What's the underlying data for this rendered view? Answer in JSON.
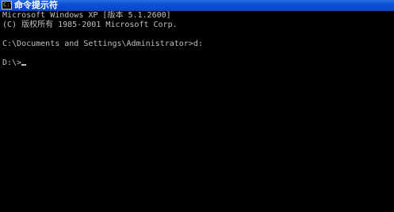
{
  "window": {
    "title": "命令提示符",
    "icon_name": "cmd-icon",
    "icon_text": "C:\\",
    "background_color": "#000000",
    "text_color": "#c0c0c0",
    "titlebar_color": "#0a52d6"
  },
  "console": {
    "lines": [
      "Microsoft Windows XP [版本 5.1.2600]",
      "(C) 版权所有 1985-2001 Microsoft Corp.",
      "",
      "C:\\Documents and Settings\\Administrator>d:",
      "",
      "D:\\>"
    ]
  }
}
